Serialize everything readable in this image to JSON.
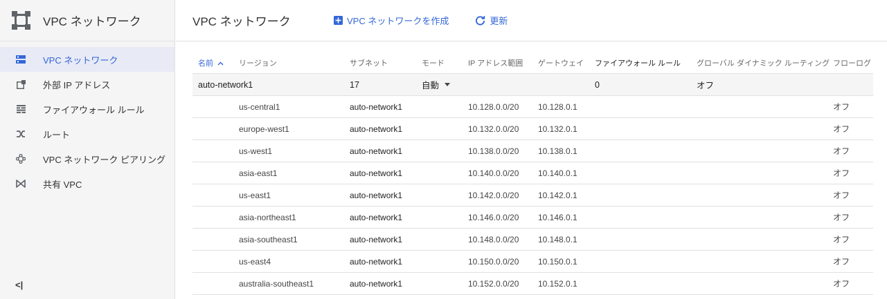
{
  "sidebar": {
    "title": "VPC ネットワーク",
    "items": [
      {
        "label": "VPC ネットワーク",
        "icon": "vpc-network-icon",
        "active": true
      },
      {
        "label": "外部 IP アドレス",
        "icon": "external-ip-icon",
        "active": false
      },
      {
        "label": "ファイアウォール ルール",
        "icon": "firewall-icon",
        "active": false
      },
      {
        "label": "ルート",
        "icon": "route-icon",
        "active": false
      },
      {
        "label": "VPC ネットワーク ピアリング",
        "icon": "peering-icon",
        "active": false
      },
      {
        "label": "共有 VPC",
        "icon": "shared-vpc-icon",
        "active": false
      }
    ],
    "collapse_label": "<|"
  },
  "header": {
    "title": "VPC ネットワーク",
    "create_label": "VPC ネットワークを作成",
    "refresh_label": "更新"
  },
  "table": {
    "columns": [
      "名前",
      "リージョン",
      "サブネット",
      "モード",
      "IP アドレス範囲",
      "ゲートウェイ",
      "ファイアウォール ルール",
      "グローバル ダイナミック ルーティング",
      "フローログ"
    ],
    "sort_indicator": "^",
    "network": {
      "name": "auto-network1",
      "subnet_count": "17",
      "mode": "自動",
      "firewall_rules": "0",
      "global_dynamic_routing": "オフ"
    },
    "rows": [
      {
        "region": "us-central1",
        "subnet": "auto-network1",
        "ip_range": "10.128.0.0/20",
        "gateway": "10.128.0.1",
        "flow_logs": "オフ"
      },
      {
        "region": "europe-west1",
        "subnet": "auto-network1",
        "ip_range": "10.132.0.0/20",
        "gateway": "10.132.0.1",
        "flow_logs": "オフ"
      },
      {
        "region": "us-west1",
        "subnet": "auto-network1",
        "ip_range": "10.138.0.0/20",
        "gateway": "10.138.0.1",
        "flow_logs": "オフ"
      },
      {
        "region": "asia-east1",
        "subnet": "auto-network1",
        "ip_range": "10.140.0.0/20",
        "gateway": "10.140.0.1",
        "flow_logs": "オフ"
      },
      {
        "region": "us-east1",
        "subnet": "auto-network1",
        "ip_range": "10.142.0.0/20",
        "gateway": "10.142.0.1",
        "flow_logs": "オフ"
      },
      {
        "region": "asia-northeast1",
        "subnet": "auto-network1",
        "ip_range": "10.146.0.0/20",
        "gateway": "10.146.0.1",
        "flow_logs": "オフ"
      },
      {
        "region": "asia-southeast1",
        "subnet": "auto-network1",
        "ip_range": "10.148.0.0/20",
        "gateway": "10.148.0.1",
        "flow_logs": "オフ"
      },
      {
        "region": "us-east4",
        "subnet": "auto-network1",
        "ip_range": "10.150.0.0/20",
        "gateway": "10.150.0.1",
        "flow_logs": "オフ"
      },
      {
        "region": "australia-southeast1",
        "subnet": "auto-network1",
        "ip_range": "10.152.0.0/20",
        "gateway": "10.152.0.1",
        "flow_logs": "オフ"
      }
    ]
  },
  "colors": {
    "accent": "#3367d6",
    "active_bg": "#e8eaf6",
    "sidebar_bg": "#f5f5f5"
  }
}
